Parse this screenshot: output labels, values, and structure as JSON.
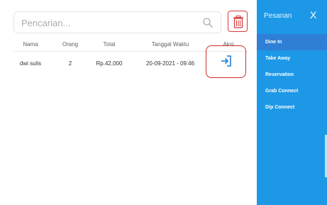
{
  "search": {
    "placeholder": "Pencarian..."
  },
  "table": {
    "columns": [
      "Nama",
      "Orang",
      "Total",
      "Tanggal Waktu",
      "Aksi"
    ],
    "rows": [
      {
        "nama": "dwi sulis",
        "orang": "2",
        "total": "Rp.42,000",
        "tanggal_waktu": "20-09-2021 - 09:46"
      }
    ]
  },
  "sidebar": {
    "title": "Pesanan",
    "close_label": "X",
    "items": [
      {
        "label": "Dine In",
        "active": true
      },
      {
        "label": "Take Away",
        "active": false
      },
      {
        "label": "Reservation",
        "active": false
      },
      {
        "label": "Grab Connect",
        "active": false
      },
      {
        "label": "Dip Connect",
        "active": false
      }
    ]
  },
  "colors": {
    "sidebar_bg": "#1d98e6",
    "sidebar_active": "#2f7fd6",
    "danger": "#d63b3b",
    "action_icon": "#1d7fd8"
  },
  "icons": {
    "search": "search-icon",
    "delete": "trash-icon",
    "action": "sign-in-icon"
  }
}
